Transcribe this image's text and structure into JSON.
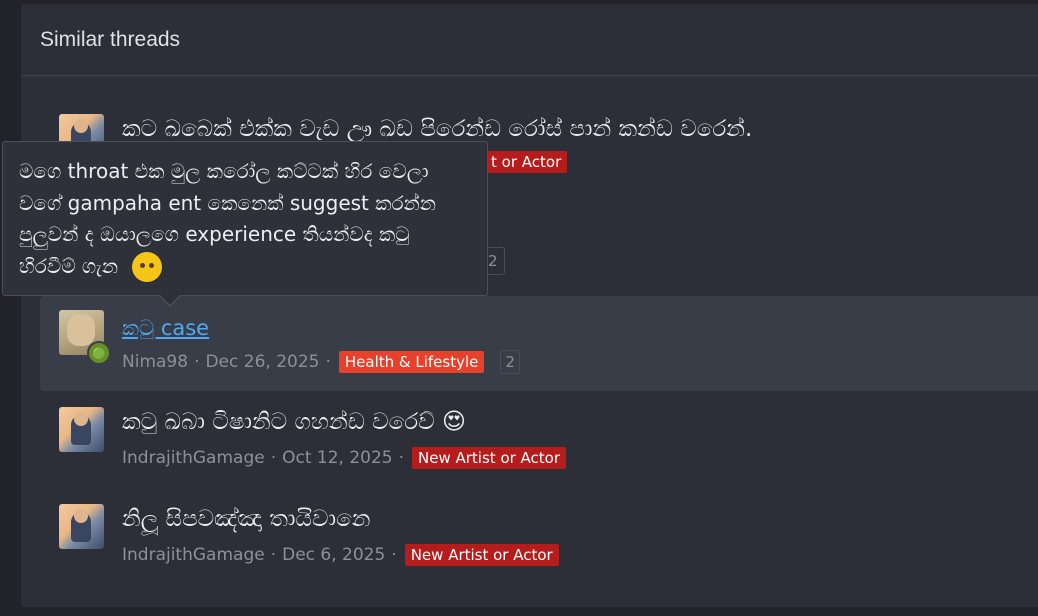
{
  "panel": {
    "title": "Similar threads"
  },
  "threads": [
    {
      "title": "කට ඛබෙක් එක්ක වැඩ ඌ ඛඩ පිරෙන්ඩ රෝස් පාන් කන්ඩ වරෙන්.",
      "author": "",
      "date": "",
      "tag": "New Artist or Actor",
      "tag_partial": "t or Actor",
      "replies": "2"
    },
    {
      "title": "කටු case",
      "author": "Nima98",
      "date": "Dec 26, 2025",
      "tag": "Health & Lifestyle",
      "replies": "2"
    },
    {
      "title": "කටු ඛබා ටිෂානිට ගහන්ඩ වරෙව් 😍",
      "author": "IndrajithGamage",
      "date": "Oct 12, 2025",
      "tag": "New Artist or Actor"
    },
    {
      "title": "නිලූ සිපවඤ්ඤා තායිවානෙ",
      "author": "IndrajithGamage",
      "date": "Dec 6, 2025",
      "tag": "New Artist or Actor"
    }
  ],
  "tooltip": {
    "text": "මගෙ throat එක මුල කරෝල කට්ටක් හිර වෙලා වගේ gampaha ent කෙනෙක් suggest කරන්න පුලුවන් ද ඔයාලගෙ experience තියන්වද කටු හිරවීම් ගැන"
  },
  "colors": {
    "background": "#212328",
    "panel": "#2c2f38",
    "highlight_row": "#393d47",
    "link": "#4fa8f0",
    "tag_red": "#b51d1d",
    "tag_orange": "#e8412b"
  }
}
